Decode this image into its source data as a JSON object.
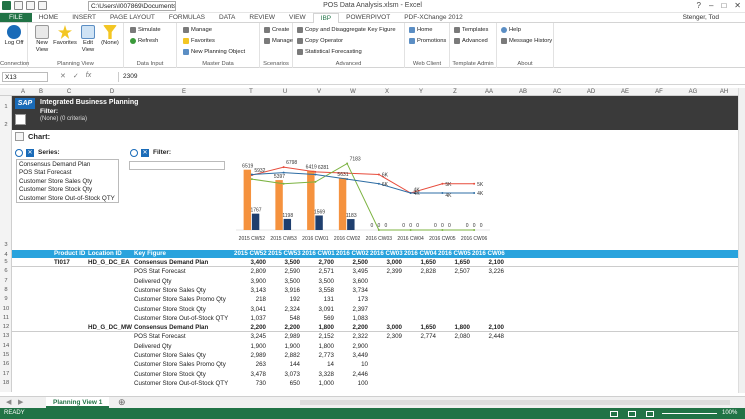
{
  "window": {
    "title": "POS Data Analysis.xlsm - Excel",
    "path": "C:\\Users\\I007869\\Documents\\S",
    "user": "Stenger, Tod"
  },
  "tabs": [
    "FILE",
    "HOME",
    "INSERT",
    "PAGE LAYOUT",
    "FORMULAS",
    "DATA",
    "REVIEW",
    "VIEW",
    "IBP",
    "POWERPIVOT",
    "PDF-XChange 2012"
  ],
  "active_tab": "IBP",
  "ribbon": {
    "groups": [
      {
        "label": "Connection",
        "buttons": [
          "Log Off"
        ]
      },
      {
        "label": "Planning View",
        "buttons": [
          "New View",
          "Favorites",
          "Edit View",
          "(None)"
        ]
      },
      {
        "label": "Data Input",
        "buttons": [
          "Simulate",
          "Refresh"
        ]
      },
      {
        "label": "Master Data",
        "buttons": [
          "Manage",
          "Favorites",
          "New Planning Object"
        ]
      },
      {
        "label": "Scenarios",
        "buttons": [
          "Create",
          "Manage"
        ]
      },
      {
        "label": "Advanced",
        "buttons": [
          "Copy and Disaggregate Key Figure",
          "Copy Operator",
          "Statistical Forecasting"
        ]
      },
      {
        "label": "Web Client",
        "buttons": [
          "Home",
          "Promotions"
        ]
      },
      {
        "label": "Template Admin",
        "buttons": [
          "Templates",
          "Advanced"
        ]
      },
      {
        "label": "About",
        "buttons": [
          "Help",
          "Message History"
        ]
      }
    ]
  },
  "formula_bar": {
    "name_box": "X13",
    "value": "2309"
  },
  "columns": [
    "A",
    "B",
    "C",
    "D",
    "E",
    "T",
    "U",
    "V",
    "W",
    "X",
    "Y",
    "Z",
    "AA",
    "AB",
    "AC",
    "AD",
    "AE",
    "AF",
    "AG",
    "AH"
  ],
  "banner": {
    "title": "Integrated Business Planning",
    "filter_label": "Filter:",
    "filter_value": "(None) (0 criteria)"
  },
  "chart_section": {
    "title": "Chart:",
    "series_label": "Series:",
    "filter_label": "Filter:",
    "series_items": [
      "Consensus Demand Plan",
      "POS Stat Forecast",
      "Customer Store Sales Qty",
      "Customer Store Stock Qty",
      "Customer Store Out-of-Stock QTY"
    ]
  },
  "chart_data": {
    "type": "bar",
    "categories": [
      "2015 CW52",
      "2015 CW53",
      "2016 CW01",
      "2016 CW02",
      "2016 CW03",
      "2016 CW04",
      "2016 CW05",
      "2016 CW06"
    ],
    "series": [
      {
        "name": "Consensus Demand Plan",
        "kind": "bar",
        "color": "#f5923e",
        "values": [
          6519,
          5397,
          6419,
          5631,
          null,
          null,
          null,
          null
        ]
      },
      {
        "name": "Customer Store Stock Qty",
        "kind": "bar",
        "color": "#1f3f6e",
        "values": [
          1767,
          1198,
          1569,
          1183,
          null,
          null,
          null,
          null
        ]
      },
      {
        "name": "POS Stat Forecast",
        "kind": "line",
        "color": "#e74c3c",
        "values": [
          5932,
          6798,
          6281,
          null,
          6000,
          4000,
          5000,
          5000
        ]
      },
      {
        "name": "Customer Store Sales Qty",
        "kind": "line",
        "color": "#7cb342",
        "values": [
          5500,
          5000,
          5200,
          7183,
          0,
          0,
          0,
          0
        ]
      },
      {
        "name": "Customer Store Out-of-Stock QTY",
        "kind": "line",
        "color": "#2e6da4",
        "values": [
          6000,
          6200,
          6000,
          5500,
          5000,
          4000,
          4000,
          4000
        ]
      }
    ],
    "data_labels": {
      "bars_primary": [
        "6519",
        "5397",
        "6419",
        "5631"
      ],
      "bars_stock": [
        "1767",
        "1198",
        "1569",
        "1183"
      ],
      "line_top": [
        "5932",
        "6798",
        "6281",
        "7183"
      ],
      "right": [
        "6K",
        "6K",
        "4K",
        "5K",
        "5K",
        "4K",
        "4K",
        "4K"
      ],
      "zeros": [
        "0",
        "0",
        "0",
        "0",
        "0",
        "0",
        "0",
        "0",
        "0",
        "0",
        "0",
        "0"
      ]
    },
    "ylim": [
      0,
      8000
    ]
  },
  "table": {
    "headers": [
      "Product ID",
      "Location ID",
      "Key Figure",
      "2015 CW52",
      "2015 CW53",
      "2016 CW01",
      "2016 CW02",
      "2016 CW03",
      "2016 CW04",
      "2016 CW05",
      "2016 CW06"
    ],
    "rows": [
      {
        "r": "5",
        "product": "TI017",
        "location": "HD_G_DC_EA",
        "kf": "Consensus Demand Plan",
        "v": [
          "3,400",
          "3,500",
          "2,700",
          "2,500",
          "3,000",
          "1,650",
          "1,650",
          "2,100"
        ],
        "bold": true
      },
      {
        "r": "6",
        "product": "",
        "location": "",
        "kf": "POS Stat Forecast",
        "v": [
          "2,809",
          "2,590",
          "2,571",
          "3,495",
          "2,399",
          "2,828",
          "2,507",
          "3,226"
        ]
      },
      {
        "r": "7",
        "product": "",
        "location": "",
        "kf": "Delivered Qty",
        "v": [
          "3,900",
          "3,500",
          "3,500",
          "3,600",
          "",
          "",
          "",
          ""
        ]
      },
      {
        "r": "8",
        "product": "",
        "location": "",
        "kf": "Customer Store Sales Qty",
        "v": [
          "3,143",
          "3,916",
          "3,558",
          "3,734",
          "",
          "",
          "",
          ""
        ]
      },
      {
        "r": "9",
        "product": "",
        "location": "",
        "kf": "Customer Store Sales Promo Qty",
        "v": [
          "218",
          "192",
          "131",
          "173",
          "",
          "",
          "",
          ""
        ]
      },
      {
        "r": "10",
        "product": "",
        "location": "",
        "kf": "Customer Store Stock Qty",
        "v": [
          "3,041",
          "2,324",
          "3,091",
          "2,397",
          "",
          "",
          "",
          ""
        ]
      },
      {
        "r": "11",
        "product": "",
        "location": "",
        "kf": "Customer Store Out-of-Stock QTY",
        "v": [
          "1,037",
          "548",
          "569",
          "1,083",
          "",
          "",
          "",
          ""
        ]
      },
      {
        "r": "12",
        "product": "",
        "location": "HD_G_DC_MW",
        "kf": "Consensus Demand Plan",
        "v": [
          "2,200",
          "2,200",
          "1,800",
          "2,200",
          "3,000",
          "1,650",
          "1,800",
          "2,100"
        ],
        "bold": true
      },
      {
        "r": "13",
        "product": "",
        "location": "",
        "kf": "POS Stat Forecast",
        "v": [
          "3,245",
          "2,989",
          "2,152",
          "2,322",
          "2,309",
          "2,774",
          "2,080",
          "2,448"
        ]
      },
      {
        "r": "14",
        "product": "",
        "location": "",
        "kf": "Delivered Qty",
        "v": [
          "1,900",
          "1,900",
          "1,800",
          "2,900",
          "",
          "",
          "",
          ""
        ]
      },
      {
        "r": "15",
        "product": "",
        "location": "",
        "kf": "Customer Store Sales Qty",
        "v": [
          "2,989",
          "2,882",
          "2,773",
          "3,449",
          "",
          "",
          "",
          ""
        ]
      },
      {
        "r": "16",
        "product": "",
        "location": "",
        "kf": "Customer Store Sales Promo Qty",
        "v": [
          "263",
          "144",
          "14",
          "10",
          "",
          "",
          "",
          ""
        ]
      },
      {
        "r": "17",
        "product": "",
        "location": "",
        "kf": "Customer Store Stock Qty",
        "v": [
          "3,478",
          "3,073",
          "3,328",
          "2,446",
          "",
          "",
          "",
          ""
        ]
      },
      {
        "r": "18",
        "product": "",
        "location": "",
        "kf": "Customer Store Out-of-Stock QTY",
        "v": [
          "730",
          "650",
          "1,000",
          "100",
          "",
          "",
          "",
          ""
        ]
      }
    ]
  },
  "row_numbers": [
    "1",
    "2",
    "3",
    "4"
  ],
  "sheet_tab": "Planning View 1",
  "status": {
    "left": "READY",
    "zoom": "100%"
  }
}
